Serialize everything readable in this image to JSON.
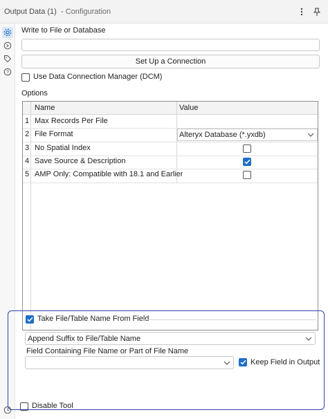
{
  "header": {
    "title": "Output Data (1)",
    "subtitle": "- Configuration",
    "more_icon": "more-vertical-icon",
    "pin_icon": "pin-icon"
  },
  "sidebar": {
    "items": [
      {
        "icon": "gear-icon",
        "active": true
      },
      {
        "icon": "arrow-circle-icon",
        "active": false
      },
      {
        "icon": "tag-icon",
        "active": false
      },
      {
        "icon": "help-icon",
        "active": false
      }
    ]
  },
  "write": {
    "label": "Write to File or Database",
    "value": "",
    "button_label": "Set Up a Connection"
  },
  "dcm": {
    "label": "Use Data Connection Manager (DCM)",
    "checked": false
  },
  "options": {
    "label": "Options",
    "columns": [
      "Name",
      "Value"
    ],
    "rows": [
      {
        "num": "1",
        "name": "Max Records Per File",
        "type": "text",
        "value": ""
      },
      {
        "num": "2",
        "name": "File Format",
        "type": "dropdown",
        "value": "Alteryx Database (*.yxdb)"
      },
      {
        "num": "3",
        "name": "No Spatial Index",
        "type": "checkbox",
        "checked": false
      },
      {
        "num": "4",
        "name": "Save Source & Description",
        "type": "checkbox",
        "checked": true
      },
      {
        "num": "5",
        "name": "AMP Only: Compatible with 18.1 and Earlier",
        "type": "checkbox",
        "checked": false
      }
    ]
  },
  "take_name": {
    "checkbox_label": "Take File/Table Name From Field",
    "checked": true,
    "mode_value": "Append Suffix to File/Table Name",
    "field_label": "Field Containing File Name or Part of File Name",
    "field_value": "",
    "keep_label": "Keep Field in Output",
    "keep_checked": true
  },
  "disable": {
    "label": "Disable Tool",
    "checked": false
  },
  "colors": {
    "accent": "#1f6fc5",
    "frame": "#2f3fa8"
  }
}
